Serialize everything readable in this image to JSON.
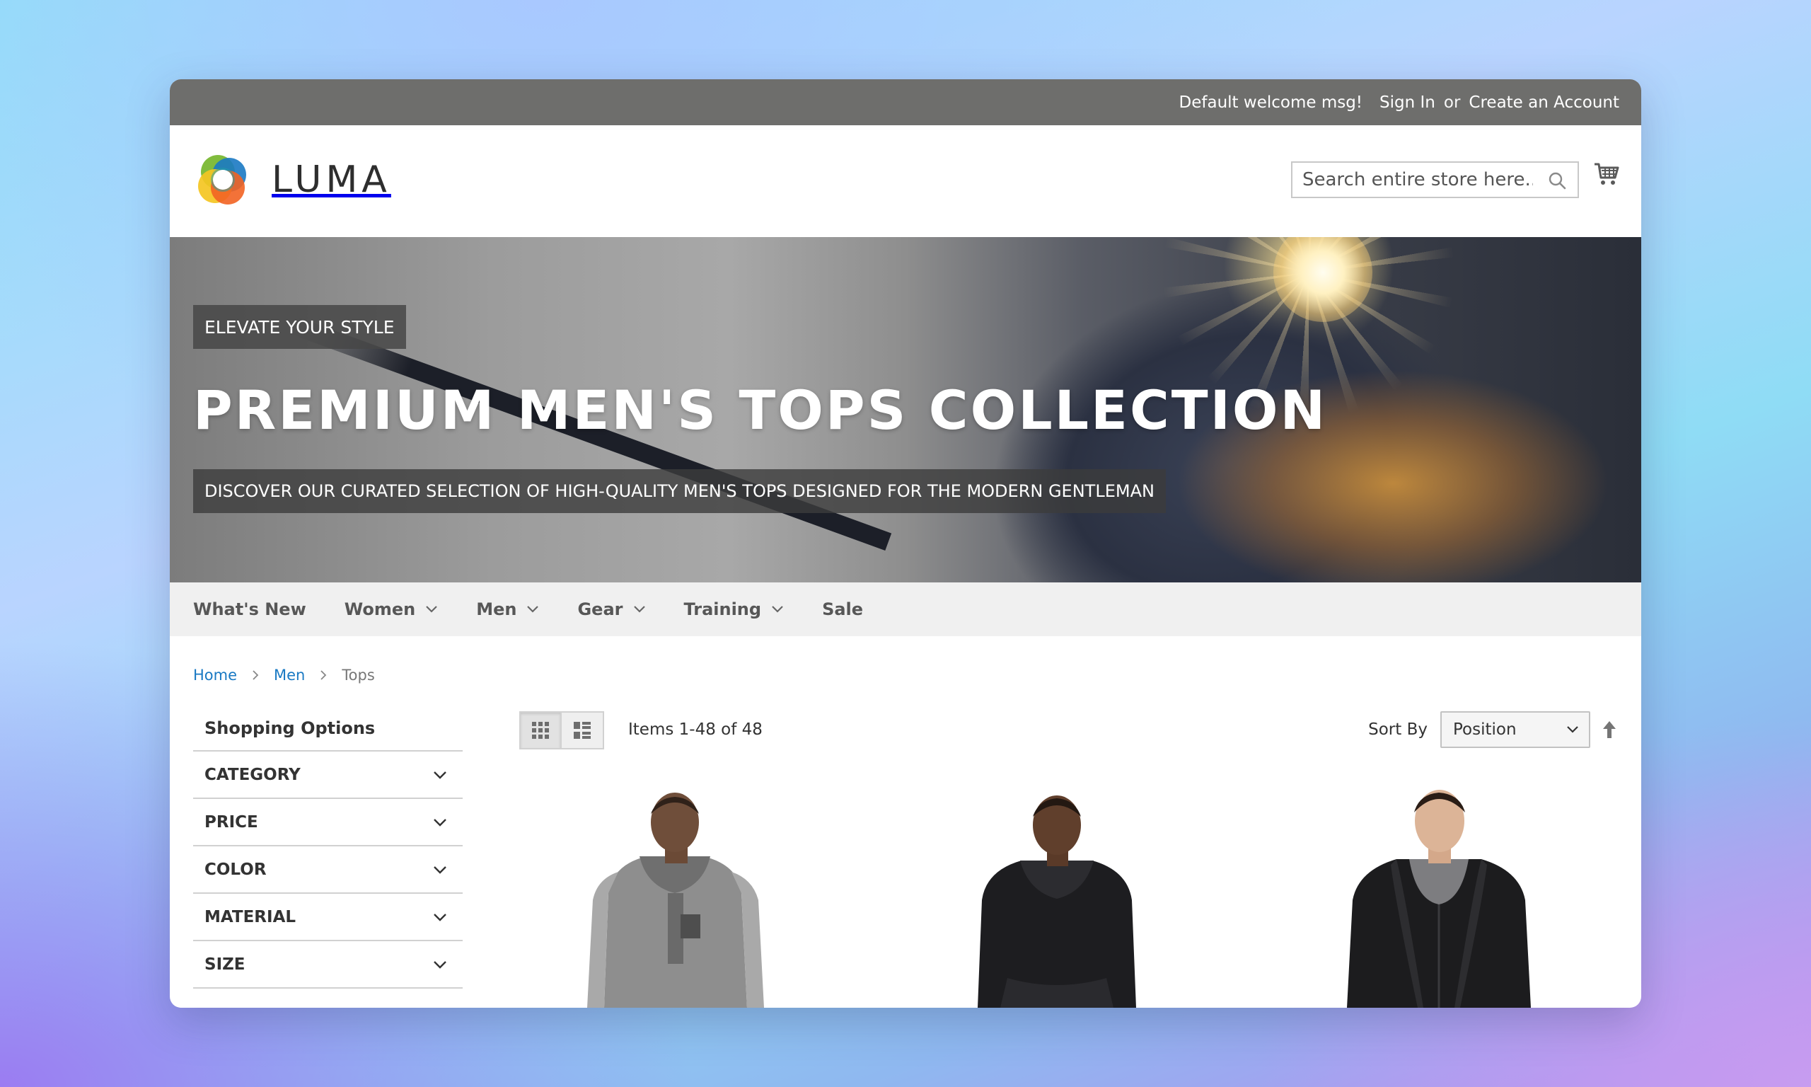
{
  "topbar": {
    "welcome": "Default welcome msg!",
    "sign_in": "Sign In",
    "or": "or",
    "create_account": "Create an Account"
  },
  "header": {
    "logo_text": "LUMA",
    "search_placeholder": "Search entire store here...",
    "search_icon": "search-icon",
    "cart_icon": "cart-icon"
  },
  "hero": {
    "tag": "ELEVATE YOUR STYLE",
    "title": "PREMIUM MEN'S TOPS COLLECTION",
    "subtitle": "DISCOVER OUR CURATED SELECTION OF HIGH-QUALITY MEN'S TOPS DESIGNED FOR THE MODERN GENTLEMAN"
  },
  "nav": {
    "items": [
      {
        "label": "What's New",
        "has_dropdown": false
      },
      {
        "label": "Women",
        "has_dropdown": true
      },
      {
        "label": "Men",
        "has_dropdown": true
      },
      {
        "label": "Gear",
        "has_dropdown": true
      },
      {
        "label": "Training",
        "has_dropdown": true
      },
      {
        "label": "Sale",
        "has_dropdown": false
      }
    ]
  },
  "breadcrumb": {
    "home": "Home",
    "men": "Men",
    "current": "Tops"
  },
  "sidebar": {
    "title": "Shopping Options",
    "filters": [
      "CATEGORY",
      "PRICE",
      "COLOR",
      "MATERIAL",
      "SIZE"
    ]
  },
  "toolbar": {
    "grid_icon": "grid-view-icon",
    "list_icon": "list-view-icon",
    "amount": "Items 1-48 of 48",
    "sort_label": "Sort By",
    "sort_value": "Position",
    "sort_direction_icon": "arrow-up-icon"
  },
  "colors": {
    "topbar_bg": "#6e6e6c",
    "nav_bg": "#f0f0f0",
    "link": "#1979c3",
    "logo_orange": "#f26322",
    "logo_blue": "#1979c3",
    "logo_green": "#7ab833",
    "logo_yellow": "#f4c622"
  },
  "products": [
    {
      "image": "hoodie-gray-model"
    },
    {
      "image": "hoodie-black-model"
    },
    {
      "image": "hoodie-zip-black-model"
    }
  ]
}
